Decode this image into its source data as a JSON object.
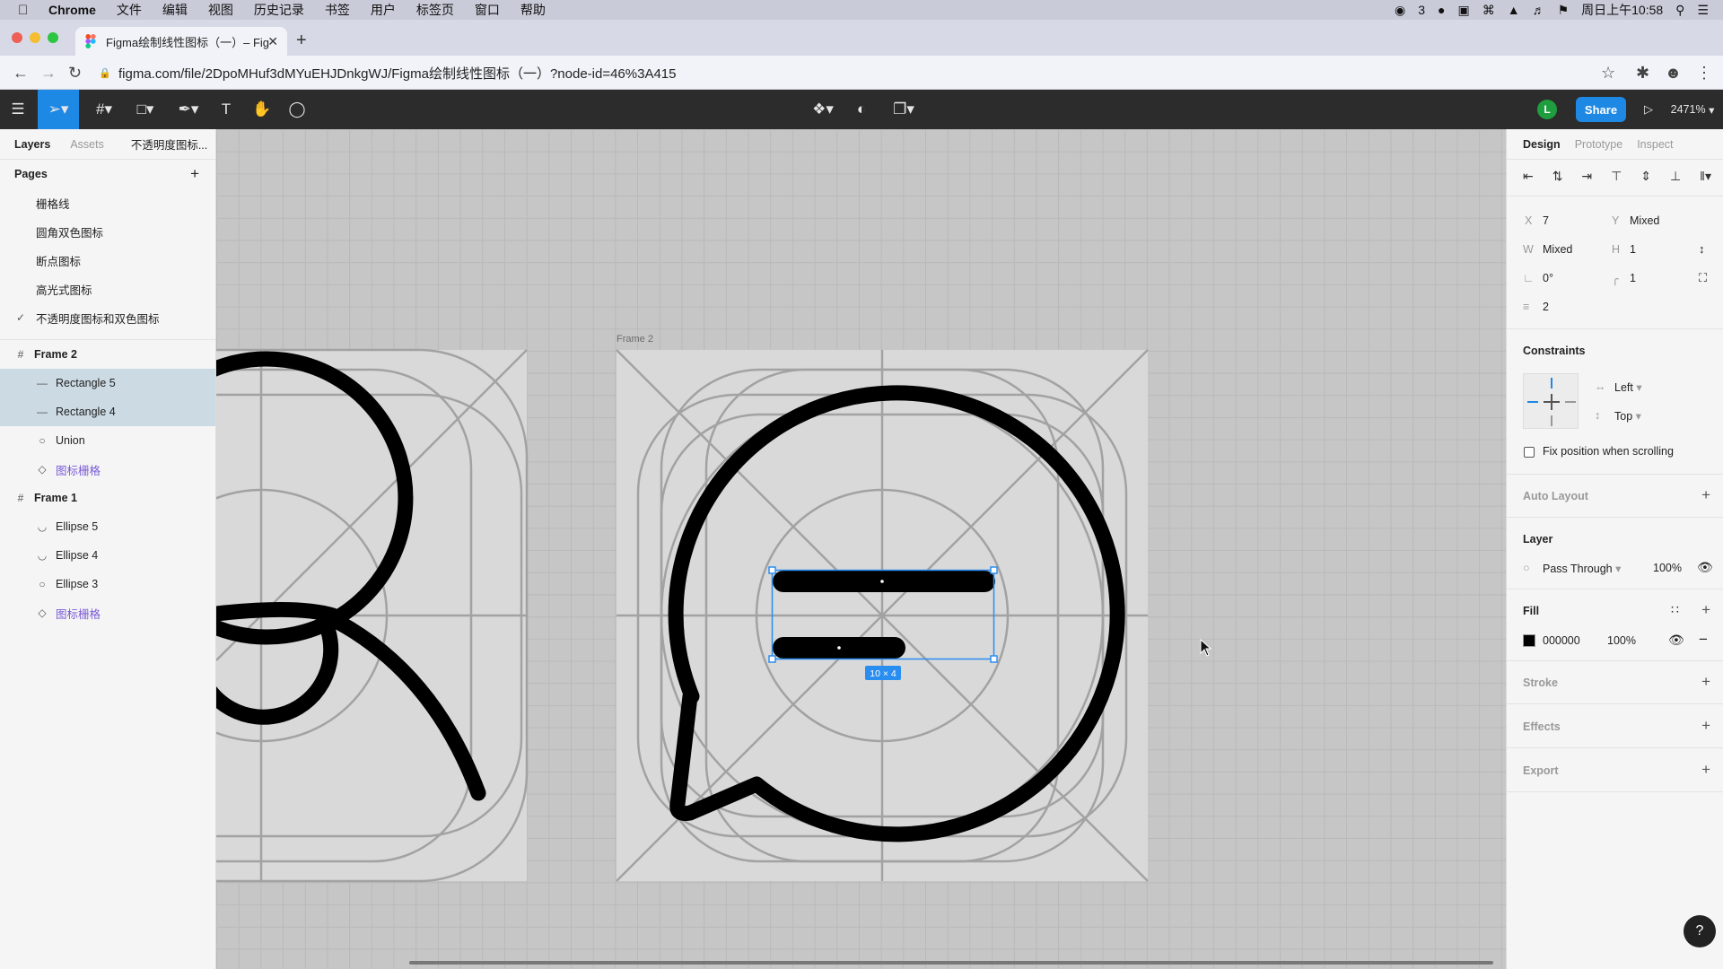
{
  "menubar": {
    "app": "Chrome",
    "items": [
      "文件",
      "编辑",
      "视图",
      "历史记录",
      "书签",
      "用户",
      "标签页",
      "窗口",
      "帮助"
    ],
    "status": {
      "wechat_count": "3",
      "clock": "周日上午10:58"
    }
  },
  "browser": {
    "tab_title": "Figma绘制线性图标（一）– Fig",
    "url": "figma.com/file/2DpoMHuf3dMYuEHJDnkgWJ/Figma绘制线性图标（一）?node-id=46%3A415"
  },
  "toolbar": {
    "share_label": "Share",
    "avatar_initial": "L",
    "zoom": "2471%"
  },
  "left_panel": {
    "tabs": [
      "Layers",
      "Assets"
    ],
    "page_selector": "不透明度图标...",
    "pages_heading": "Pages",
    "pages": [
      "栅格线",
      "圆角双色图标",
      "断点图标",
      "高光式图标",
      "不透明度图标和双色图标"
    ],
    "current_page_index": 4,
    "layers": [
      {
        "label": "Frame 2",
        "icon": "frame-icon",
        "indent": 0,
        "selected": false,
        "component": false
      },
      {
        "label": "Rectangle 5",
        "icon": "rectangle-line-icon",
        "indent": 1,
        "selected": true,
        "component": false
      },
      {
        "label": "Rectangle 4",
        "icon": "rectangle-line-icon",
        "indent": 1,
        "selected": true,
        "component": false
      },
      {
        "label": "Union",
        "icon": "union-icon",
        "indent": 1,
        "selected": false,
        "component": false
      },
      {
        "label": "图标栅格",
        "icon": "component-instance-icon",
        "indent": 1,
        "selected": false,
        "component": true
      },
      {
        "label": "Frame 1",
        "icon": "frame-icon",
        "indent": 0,
        "selected": false,
        "component": false
      },
      {
        "label": "Ellipse 5",
        "icon": "ellipse-arc-icon",
        "indent": 1,
        "selected": false,
        "component": false
      },
      {
        "label": "Ellipse 4",
        "icon": "ellipse-arc-icon",
        "indent": 1,
        "selected": false,
        "component": false
      },
      {
        "label": "Ellipse 3",
        "icon": "ellipse-icon",
        "indent": 1,
        "selected": false,
        "component": false
      },
      {
        "label": "图标栅格",
        "icon": "component-instance-icon",
        "indent": 1,
        "selected": false,
        "component": true
      }
    ]
  },
  "canvas": {
    "frame_label": "Frame 2",
    "selection_size": "10 × 4"
  },
  "right_panel": {
    "tabs": [
      "Design",
      "Prototype",
      "Inspect"
    ],
    "x_label": "X",
    "x": "7",
    "y_label": "Y",
    "y": "Mixed",
    "w_label": "W",
    "w": "Mixed",
    "h_label": "H",
    "h": "1",
    "rotation": "0°",
    "radius": "1",
    "spacing": "2",
    "constraints_heading": "Constraints",
    "constraint_h": "Left",
    "constraint_v": "Top",
    "fix_position": "Fix position when scrolling",
    "auto_layout": "Auto Layout",
    "layer_heading": "Layer",
    "blend_mode": "Pass Through",
    "layer_opacity": "100%",
    "fill_heading": "Fill",
    "fill_hex": "000000",
    "fill_color": "#000000",
    "fill_opacity": "100%",
    "stroke": "Stroke",
    "effects": "Effects",
    "export": "Export",
    "help": "?"
  },
  "colors": {
    "accent": "#1e88e5",
    "selection": "#2a8df0",
    "toolbar_bg": "#2c2c2c"
  }
}
